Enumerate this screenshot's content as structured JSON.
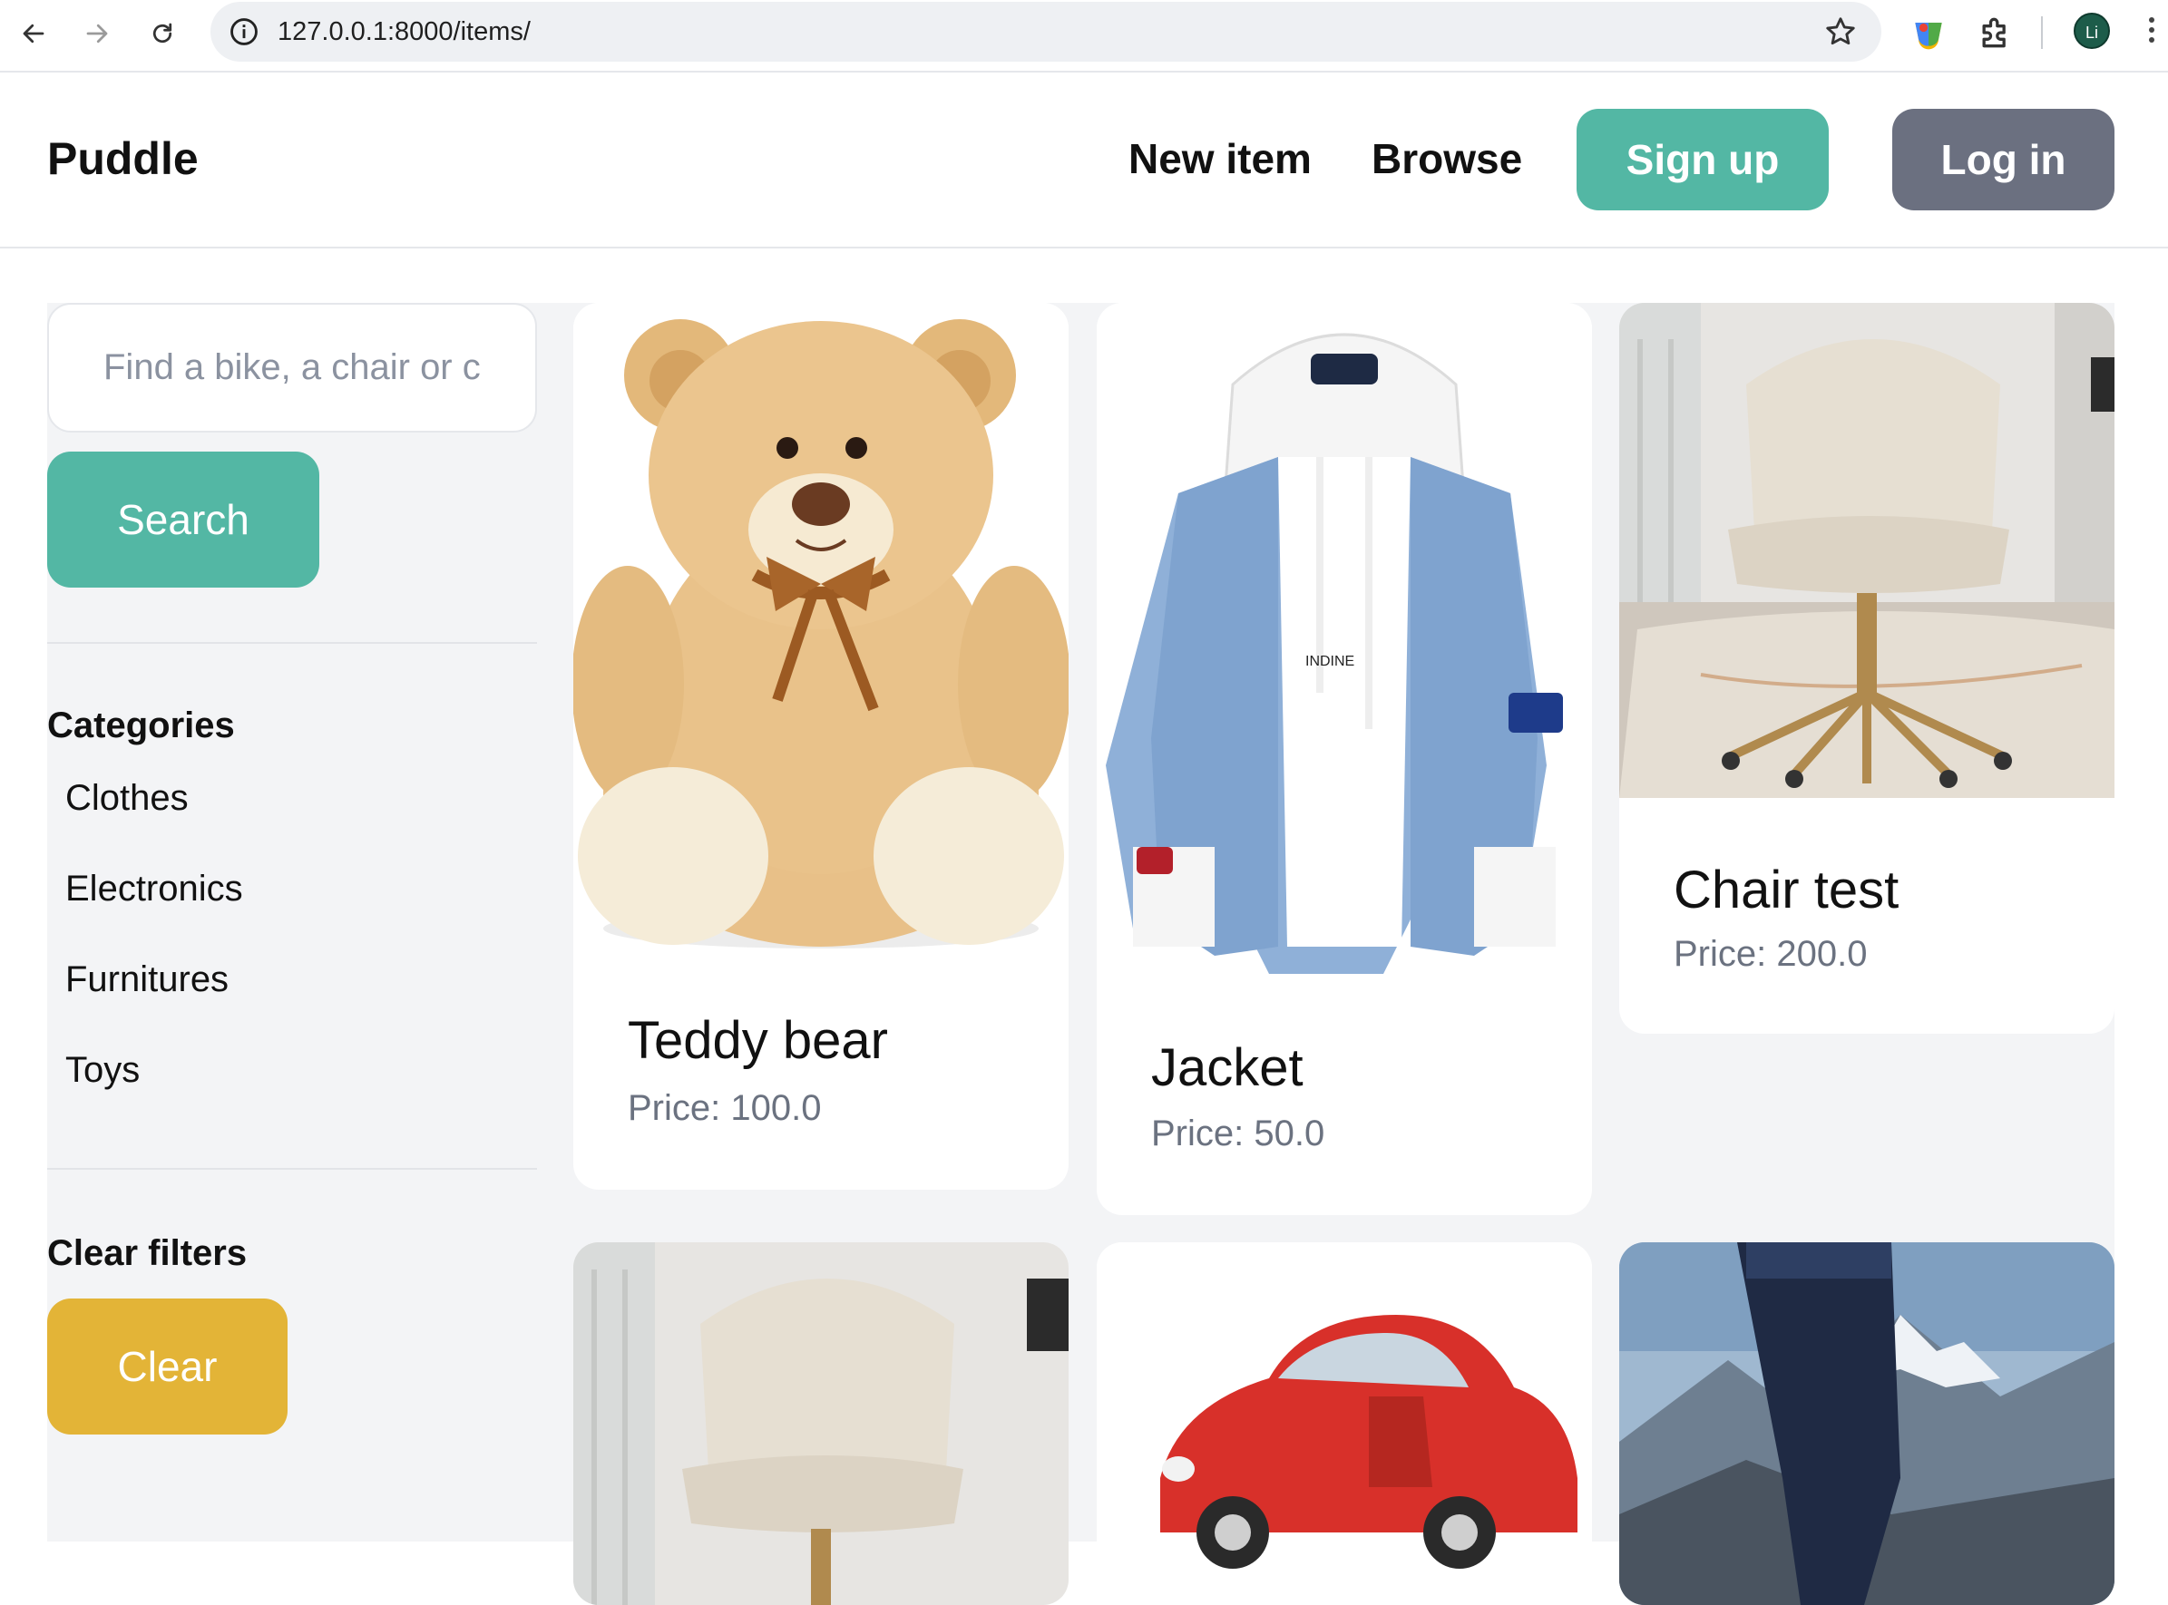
{
  "browser": {
    "url": "127.0.0.1:8000/items/",
    "profile_initials": "Li"
  },
  "header": {
    "logo": "Puddle",
    "nav": {
      "new_item": "New item",
      "browse": "Browse"
    },
    "signup_label": "Sign up",
    "login_label": "Log in"
  },
  "sidebar": {
    "search_placeholder": "Find a bike, a chair or c",
    "search_button": "Search",
    "categories_heading": "Categories",
    "categories": [
      "Clothes",
      "Electronics",
      "Furnitures",
      "Toys"
    ],
    "clear_heading": "Clear filters",
    "clear_button": "Clear"
  },
  "items": [
    {
      "title": "Teddy bear",
      "price": "Price: 100.0",
      "image": "teddy-bear"
    },
    {
      "title": "Jacket",
      "price": "Price: 50.0",
      "image": "denim-jacket"
    },
    {
      "title": "Chair test",
      "price": "Price: 200.0",
      "image": "office-chair"
    },
    {
      "title": "",
      "price": "",
      "image": "office-chair"
    },
    {
      "title": "",
      "price": "",
      "image": "red-toy-car"
    },
    {
      "title": "",
      "price": "",
      "image": "hiker-mountains"
    }
  ],
  "colors": {
    "accent_teal": "#53b7a4",
    "login_gray": "#6b7080",
    "clear_yellow": "#e3b437",
    "main_bg": "#f3f4f6"
  }
}
